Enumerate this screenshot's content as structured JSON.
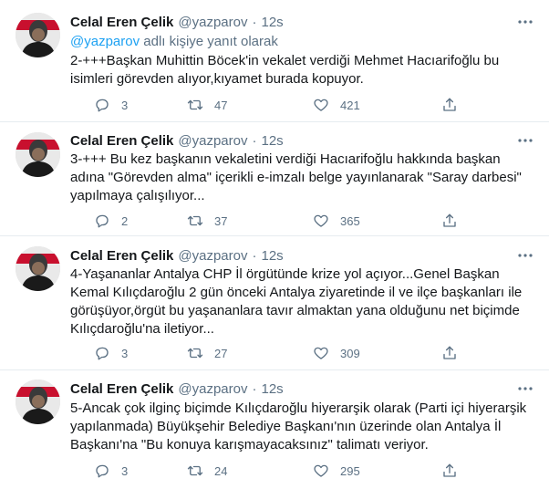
{
  "tweets": [
    {
      "name": "Celal Eren Çelik",
      "handle": "@yazparov",
      "dot": "·",
      "time": "12s",
      "replying_mention": "@yazparov",
      "replying_suffix": " adlı kişiye yanıt olarak",
      "text": "2-+++Başkan Muhittin Böcek'in vekalet verdiği Mehmet Hacıarifoğlu bu isimleri görevden alıyor,kıyamet burada kopuyor.",
      "replies": "3",
      "retweets": "47",
      "likes": "421"
    },
    {
      "name": "Celal Eren Çelik",
      "handle": "@yazparov",
      "dot": "·",
      "time": "12s",
      "text": "3-+++ Bu kez başkanın vekaletini verdiği Hacıarifoğlu hakkında başkan adına \"Görevden alma\" içerikli e-imzalı belge yayınlanarak \"Saray darbesi\" yapılmaya çalışılıyor...",
      "replies": "2",
      "retweets": "37",
      "likes": "365"
    },
    {
      "name": "Celal Eren Çelik",
      "handle": "@yazparov",
      "dot": "·",
      "time": "12s",
      "text": "4-Yaşananlar Antalya CHP İl örgütünde krize yol açıyor...Genel Başkan Kemal Kılıçdaroğlu 2 gün önceki Antalya ziyaretinde il ve ilçe başkanları ile görüşüyor,örgüt bu yaşananlara tavır almaktan yana olduğunu net biçimde Kılıçdaroğlu'na iletiyor...",
      "replies": "3",
      "retweets": "27",
      "likes": "309"
    },
    {
      "name": "Celal Eren Çelik",
      "handle": "@yazparov",
      "dot": "·",
      "time": "12s",
      "text": "5-Ancak çok ilginç biçimde Kılıçdaroğlu hiyerarşik olarak (Parti içi hiyerarşik yapılanmada) Büyükşehir Belediye Başkanı'nın üzerinde olan Antalya İl Başkanı'na \"Bu konuya karışmayacaksınız\" talimatı veriyor.",
      "replies": "3",
      "retweets": "24",
      "likes": "295"
    }
  ],
  "icons": {
    "reply": "reply-icon",
    "retweet": "retweet-icon",
    "like": "like-icon",
    "share": "share-icon",
    "more": "more-icon"
  },
  "colors": {
    "accent": "#1da1f2",
    "secondary_text": "#5b7083",
    "divider": "#e6ecf0",
    "avatar_banner": "#c8102e"
  }
}
